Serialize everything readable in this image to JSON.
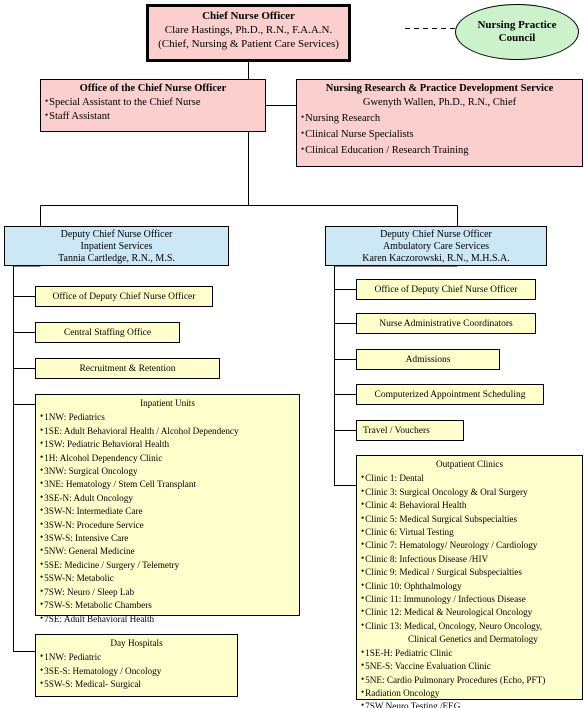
{
  "colors": {
    "executive_fill": "#fbcfce",
    "deputy_fill": "#cce8f7",
    "unit_fill": "#ffffcc",
    "council_fill": "#ccf2cc",
    "line": "#000000"
  },
  "chief_nurse_officer": {
    "title": "Chief Nurse Officer",
    "name": "Clare Hastings, Ph.D., R.N., F.A.A.N.",
    "role": "(Chief, Nursing & Patient Care Services)"
  },
  "nursing_practice_council": {
    "label_line1": "Nursing Practice",
    "label_line2": "Council"
  },
  "office_of_cno": {
    "title": "Office of the Chief Nurse Officer",
    "items": [
      "Special Assistant to the Chief Nurse",
      "Staff Assistant"
    ]
  },
  "nursing_research": {
    "title": "Nursing Research & Practice  Development Service",
    "chief": "Gwenyth Wallen, Ph.D., R.N., Chief",
    "items": [
      "Nursing Research",
      "Clinical Nurse Specialists",
      "Clinical Education / Research Training"
    ]
  },
  "deputy_inpatient": {
    "title": "Deputy Chief Nurse Officer",
    "division": "Inpatient Services",
    "name": "Tannia Cartledge, R.N., M.S."
  },
  "deputy_ambulatory": {
    "title": "Deputy Chief Nurse Officer",
    "division": "Ambulatory Care Services",
    "name": "Karen Kaczorowski,  R.N., M.H.S.A."
  },
  "inpatient_branches": [
    {
      "label": "Office of Deputy Chief Nurse Officer"
    },
    {
      "label": "Central Staffing Office"
    },
    {
      "label": "Recruitment & Retention"
    }
  ],
  "inpatient_units": {
    "title": "Inpatient Units",
    "items": [
      "1NW: Pediatrics",
      "1SE: Adult Behavioral  Health / Alcohol Dependency",
      "1SW: Pediatric Behavioral  Health",
      "1H: Alcohol Dependency  Clinic",
      "3NW: Surgical  Oncology",
      "3NE: Hematology / Stem Cell Transplant",
      "3SE-N: Adult Oncology",
      "3SW-N: Intermediate  Care",
      "3SW-N: Procedure  Service",
      "3SW-S: Intensive Care",
      "5NW:  General  Medicine",
      "5SE: Medicine / Surgery / Telemetry",
      "5SW-N: Metabolic",
      "7SW: Neuro / Sleep Lab",
      "7SW-S: Metabolic  Chambers",
      "7SE: Adult Behavioral  Health"
    ]
  },
  "day_hospitals": {
    "title": "Day Hospitals",
    "items": [
      "1NW: Pediatric",
      "3SE-S: Hematology / Oncology",
      "5SW-S: Medical-  Surgical"
    ]
  },
  "ambulatory_branches": [
    {
      "label": "Office of Deputy Chief Nurse Officer"
    },
    {
      "label": "Nurse Administrative  Coordinators"
    },
    {
      "label": "Admissions"
    },
    {
      "label": "Computerized  Appointment  Scheduling"
    },
    {
      "label": "Travel / Vouchers"
    }
  ],
  "outpatient_clinics": {
    "title": "Outpatient Clinics",
    "items": [
      {
        "text": "Clinic 1: Dental",
        "continuation": false
      },
      {
        "text": "Clinic 3: Surgical  Oncology & Oral  Surgery",
        "continuation": false
      },
      {
        "text": "Clinic 4: Behavioral  Health",
        "continuation": false
      },
      {
        "text": "Clinic 5: Medical  Surgical  Subspecialties",
        "continuation": false
      },
      {
        "text": "Clinic 6: Virtual  Testing",
        "continuation": false
      },
      {
        "text": "Clinic 7: Hematology/ Neurology / Cardiology",
        "continuation": false
      },
      {
        "text": "Clinic 8: Infectious  Disease /HIV",
        "continuation": false
      },
      {
        "text": "Clinic 9: Medical  / Surgical Subspecialties",
        "continuation": false
      },
      {
        "text": "Clinic 10: Ophthalmology",
        "continuation": false
      },
      {
        "text": "Clinic 11: Immunology  / Infectious  Disease",
        "continuation": false
      },
      {
        "text": "Clinic 12: Medical  & Neurological  Oncology",
        "continuation": false
      },
      {
        "text": "Clinic 13: Medical,  Oncology, Neuro  Oncology,",
        "continuation": false
      },
      {
        "text": "Clinical  Genetics  and Dermatology",
        "continuation": true
      },
      {
        "text": "1SE-H: Pediatric  Clinic",
        "continuation": false
      },
      {
        "text": "5NE-S:  Vaccine  Evaluation Clinic",
        "continuation": false
      },
      {
        "text": "5NE: Cardio Pulmonary Procedures  (Echo, PFT)",
        "continuation": false
      },
      {
        "text": "Radiation Oncology",
        "continuation": false
      },
      {
        "text": "7SW Neuro  Testing /EEG",
        "continuation": false
      }
    ]
  }
}
